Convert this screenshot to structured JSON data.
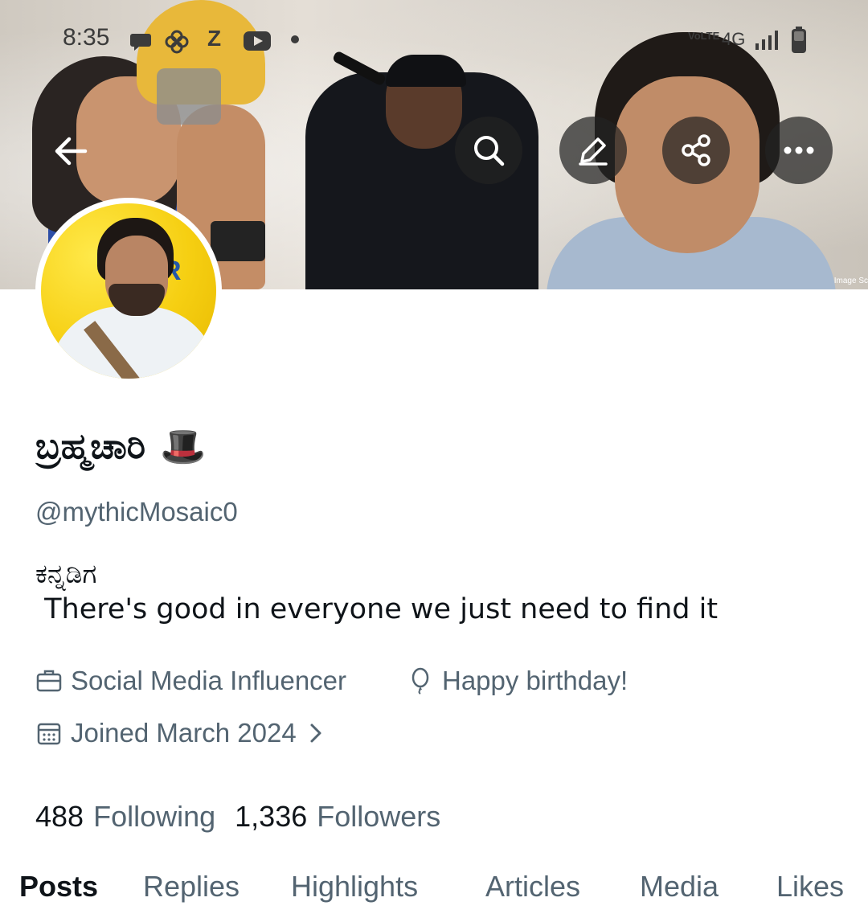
{
  "status_bar": {
    "time": "8:35",
    "z_label": "Z",
    "network_volte": "VoLTE",
    "network": "4G",
    "icons": [
      "chat-bubble-icon",
      "pinwheel-icon",
      "z-icon",
      "youtube-icon",
      "dot-icon",
      "signal-icon",
      "battery-icon"
    ]
  },
  "banner": {
    "image_credit": "Image Sc"
  },
  "header_buttons": [
    "back-arrow-icon",
    "search-icon",
    "edit-icon",
    "share-icon",
    "more-icon"
  ],
  "profile": {
    "display_name": "ಬ್ರಹ್ಮಚಾರಿ",
    "name_emoji": "🎩",
    "handle": "@mythicMosaic0",
    "bio_line1": "ಕನ್ನಡಿಗ",
    "bio_line2": " There's good in everyone we just need to find it",
    "profession": "Social Media Influencer",
    "birthday": "Happy birthday!",
    "joined": "Joined March 2024",
    "following_count": "488",
    "following_label": "Following",
    "followers_count": "1,336",
    "followers_label": "Followers"
  },
  "tabs": [
    "Posts",
    "Replies",
    "Highlights",
    "Articles",
    "Media",
    "Likes"
  ],
  "colors": {
    "text_primary": "#0f1419",
    "text_secondary": "#536471",
    "overlay_button": "#232323"
  }
}
